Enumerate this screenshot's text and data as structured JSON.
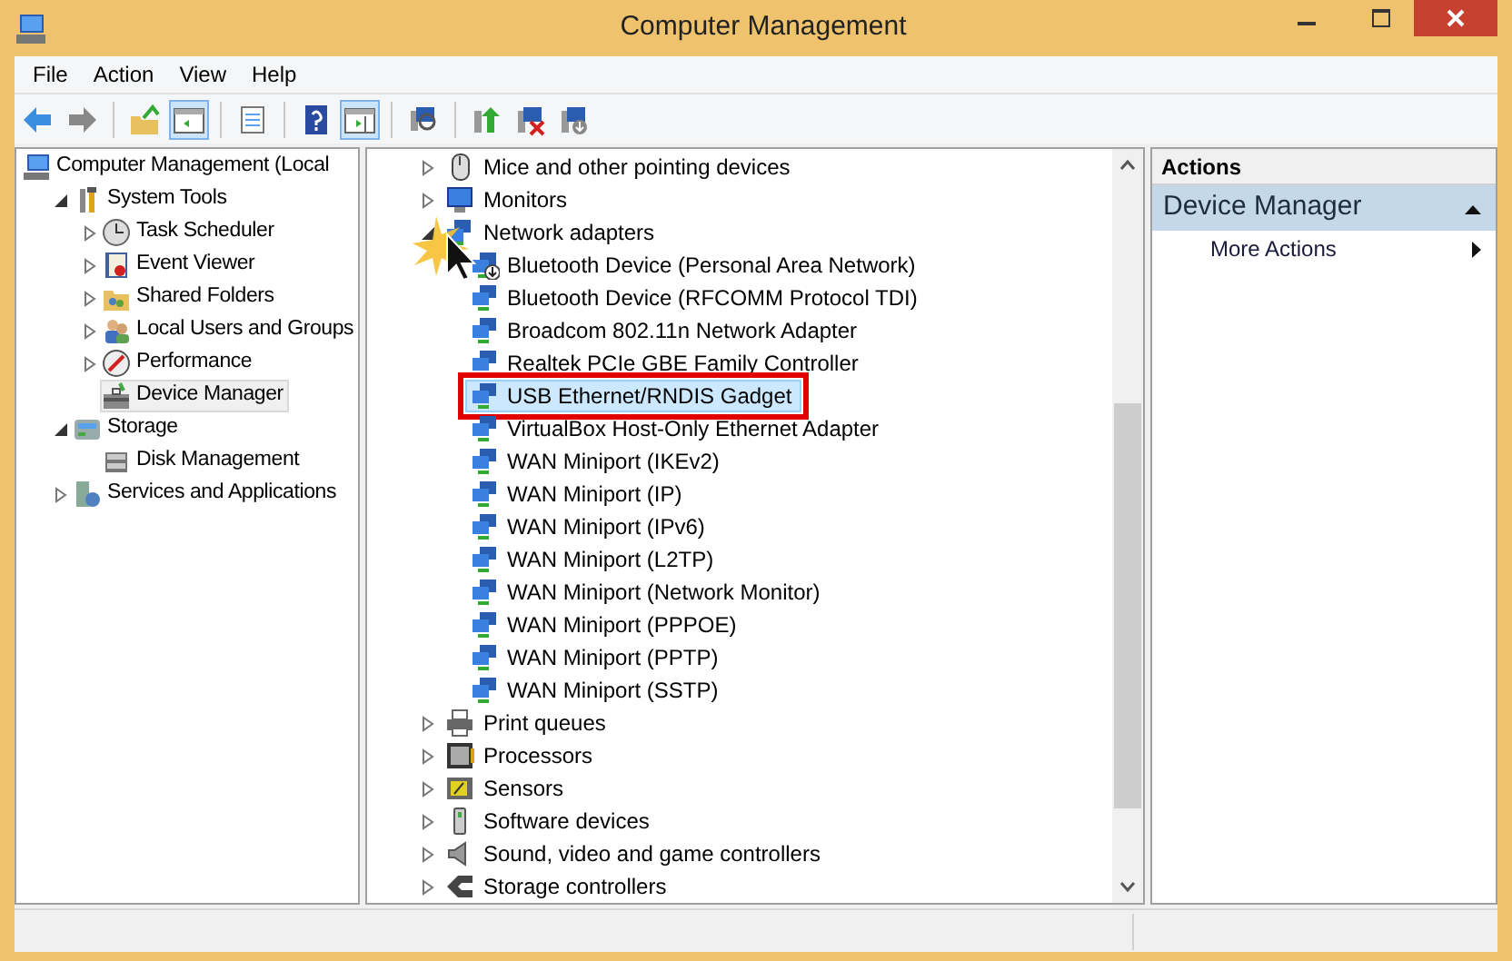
{
  "window": {
    "title": "Computer Management"
  },
  "menu": [
    "File",
    "Action",
    "View",
    "Help"
  ],
  "toolbar": [
    {
      "kind": "back",
      "pressed": false
    },
    {
      "kind": "forward",
      "pressed": false
    },
    {
      "kind": "separator"
    },
    {
      "kind": "up",
      "pressed": false
    },
    {
      "kind": "tree-pane",
      "pressed": true
    },
    {
      "kind": "separator"
    },
    {
      "kind": "export",
      "pressed": false
    },
    {
      "kind": "separator"
    },
    {
      "kind": "help",
      "pressed": false
    },
    {
      "kind": "action-pane",
      "pressed": true
    },
    {
      "kind": "separator"
    },
    {
      "kind": "scan",
      "pressed": false
    },
    {
      "kind": "separator"
    },
    {
      "kind": "update",
      "pressed": false
    },
    {
      "kind": "uninstall",
      "pressed": false
    },
    {
      "kind": "disable",
      "pressed": false
    }
  ],
  "console_tree": [
    {
      "label": "Computer Management (Local",
      "kind": "computer",
      "expandable": false,
      "selected": false,
      "children": [
        {
          "label": "System Tools",
          "kind": "tools",
          "expandable": true,
          "expanded": true,
          "selected": false,
          "children": [
            {
              "label": "Task Scheduler",
              "kind": "clock",
              "expandable": true,
              "expanded": false,
              "selected": false
            },
            {
              "label": "Event Viewer",
              "kind": "log",
              "expandable": true,
              "expanded": false,
              "selected": false
            },
            {
              "label": "Shared Folders",
              "kind": "folder",
              "expandable": true,
              "expanded": false,
              "selected": false
            },
            {
              "label": "Local Users and Groups",
              "kind": "users",
              "expandable": true,
              "expanded": false,
              "selected": false
            },
            {
              "label": "Performance",
              "kind": "gauge",
              "expandable": true,
              "expanded": false,
              "selected": false
            },
            {
              "label": "Device Manager",
              "kind": "toolbox",
              "expandable": false,
              "selected": true
            }
          ]
        },
        {
          "label": "Storage",
          "kind": "storage",
          "expandable": true,
          "expanded": true,
          "selected": false,
          "children": [
            {
              "label": "Disk Management",
              "kind": "disk",
              "expandable": false,
              "selected": false
            }
          ]
        },
        {
          "label": "Services and Applications",
          "kind": "services",
          "expandable": true,
          "expanded": false,
          "selected": false
        }
      ]
    }
  ],
  "device_tree": [
    {
      "label": "Mice and other pointing devices",
      "kind": "mouse",
      "expanded": false
    },
    {
      "label": "Monitors",
      "kind": "monitor",
      "expanded": false
    },
    {
      "label": "Network adapters",
      "kind": "network",
      "expanded": true,
      "children": [
        {
          "label": "Bluetooth Device (Personal Area Network)",
          "disabled": true,
          "selected": false,
          "annotated": false
        },
        {
          "label": "Bluetooth Device (RFCOMM Protocol TDI)",
          "disabled": false,
          "selected": false,
          "annotated": false
        },
        {
          "label": "Broadcom 802.11n Network Adapter",
          "disabled": false,
          "selected": false,
          "annotated": false
        },
        {
          "label": "Realtek PCIe GBE Family Controller",
          "disabled": false,
          "selected": false,
          "annotated": false
        },
        {
          "label": "USB Ethernet/RNDIS Gadget",
          "disabled": false,
          "selected": true,
          "annotated": true
        },
        {
          "label": "VirtualBox Host-Only Ethernet Adapter",
          "disabled": false,
          "selected": false,
          "annotated": false
        },
        {
          "label": "WAN Miniport (IKEv2)",
          "disabled": false,
          "selected": false,
          "annotated": false
        },
        {
          "label": "WAN Miniport (IP)",
          "disabled": false,
          "selected": false,
          "annotated": false
        },
        {
          "label": "WAN Miniport (IPv6)",
          "disabled": false,
          "selected": false,
          "annotated": false
        },
        {
          "label": "WAN Miniport (L2TP)",
          "disabled": false,
          "selected": false,
          "annotated": false
        },
        {
          "label": "WAN Miniport (Network Monitor)",
          "disabled": false,
          "selected": false,
          "annotated": false
        },
        {
          "label": "WAN Miniport (PPPOE)",
          "disabled": false,
          "selected": false,
          "annotated": false
        },
        {
          "label": "WAN Miniport (PPTP)",
          "disabled": false,
          "selected": false,
          "annotated": false
        },
        {
          "label": "WAN Miniport (SSTP)",
          "disabled": false,
          "selected": false,
          "annotated": false
        }
      ]
    },
    {
      "label": "Print queues",
      "kind": "printer",
      "expanded": false
    },
    {
      "label": "Processors",
      "kind": "chip",
      "expanded": false
    },
    {
      "label": "Sensors",
      "kind": "sensor",
      "expanded": false
    },
    {
      "label": "Software devices",
      "kind": "software",
      "expanded": false
    },
    {
      "label": "Sound, video and game controllers",
      "kind": "speaker",
      "expanded": false
    },
    {
      "label": "Storage controllers",
      "kind": "storage-ctrl",
      "expanded": false
    }
  ],
  "actions": {
    "header": "Actions",
    "sections": [
      {
        "title": "Device Manager",
        "expanded": true,
        "items": [
          {
            "label": "More Actions",
            "submenu": true
          }
        ]
      }
    ]
  }
}
